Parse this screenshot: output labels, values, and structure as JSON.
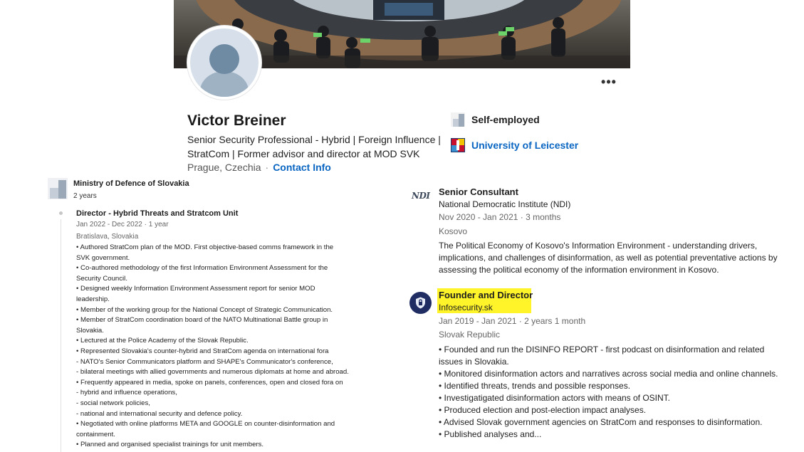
{
  "profile": {
    "name": "Victor Breiner",
    "headline_line1": "Senior Security Professional - Hybrid | Foreign Influence |",
    "headline_line2": "StratCom | Former advisor and director at MOD SVK",
    "location": "Prague, Czechia",
    "separator": "·",
    "contact_label": "Contact Info",
    "more_label": "•••",
    "companies": [
      {
        "name": "Self-employed",
        "icon": "company-logo-icon"
      },
      {
        "name": "University of Leicester",
        "icon": "university-logo-icon"
      }
    ]
  },
  "left_experience": {
    "company": "Ministry of Defence of Slovakia",
    "duration": "2 years",
    "role": {
      "title": "Director - Hybrid Threats and Stratcom Unit",
      "dates": "Jan 2022 - Dec 2022 · 1 year",
      "location": "Bratislava, Slovakia",
      "lines": [
        "• Authored StratCom plan of the MOD. First objective-based comms framework in the",
        "SVK government.",
        "• Co-authored methodology of the first Information Environment Assessment for the",
        "Security Council.",
        "• Designed weekly Information Environment Assessment report for senior MOD",
        "leadership.",
        "• Member of the working group for the National Concept of Strategic Communication.",
        "• Member of StratCom coordination board of the NATO Multinational Battle group in",
        "Slovakia.",
        "• Lectured at the Police Academy of the Slovak Republic.",
        "• Represented Slovakia's counter-hybrid and StratCom agenda on international fora",
        "- NATO's Senior Communicators platform and SHAPE's Communicator's conference,",
        "- bilateral meetings with allied governments and numerous diplomats at home and abroad.",
        "• Frequently appeared in media, spoke on panels, conferences, open and closed fora on",
        "- hybrid and influence operations,",
        "- social network policies,",
        "- national and international security and defence policy.",
        "• Negotiated with online platforms META and GOOGLE on counter-disinformation and",
        "containment.",
        "• Planned and organised specialist trainings for unit members."
      ]
    }
  },
  "right_experience": [
    {
      "logo_text": "NDI",
      "title": "Senior Consultant",
      "org": "National Democratic Institute (NDI)",
      "dates": "Nov 2020 - Jan 2021 · 3 months",
      "location": "Kosovo",
      "lines": [
        "The Political Economy of Kosovo's Information Environment - understanding drivers,",
        "implications, and challenges of disinformation, as well as potential preventative actions by",
        "assessing the political economy of the information environment in Kosovo."
      ]
    },
    {
      "title": "Founder and Director",
      "org": "Infosecurity.sk",
      "dates": "Jan 2019 - Jan 2021 · 2 years 1 month",
      "location": "Slovak Republic",
      "highlight_color": "#fff32a",
      "lines": [
        "• Founded and run the DISINFO REPORT - first podcast on disinformation and related",
        "issues in Slovakia.",
        "• Monitored disinformation actors and narratives across social media and online channels.",
        "• Identified threats, trends and possible responses.",
        "• Investigatigated disinformation actors with means of OSINT.",
        "• Produced election and post-election impact analyses.",
        "• Advised Slovak government agencies on StratCom and responses to disinformation.",
        "• Published analyses and..."
      ]
    }
  ],
  "colors": {
    "link": "#0a66c2",
    "highlight": "#fff32a",
    "infosecurity_logo": "#1f2d63"
  }
}
